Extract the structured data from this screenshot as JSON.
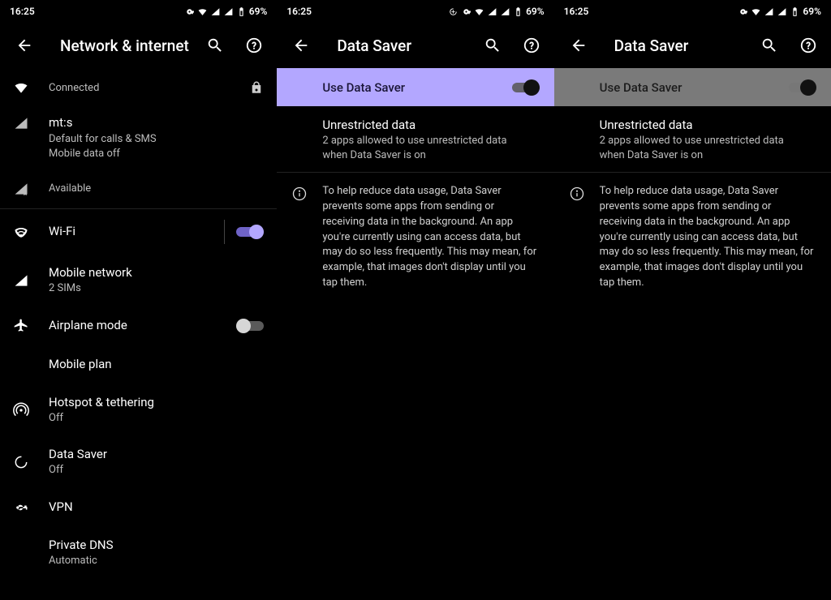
{
  "status": {
    "time": "16:25",
    "battery": "69%"
  },
  "panel1": {
    "title": "Network & internet",
    "rows": {
      "connected": {
        "sub": "Connected"
      },
      "mts": {
        "title": "mt:s",
        "sub1": "Default for calls & SMS",
        "sub2": "Mobile data off"
      },
      "available": {
        "sub": "Available"
      },
      "wifi": {
        "title": "Wi-Fi"
      },
      "mobilenet": {
        "title": "Mobile network",
        "sub": "2 SIMs"
      },
      "airplane": {
        "title": "Airplane mode"
      },
      "mobileplan": {
        "title": "Mobile plan"
      },
      "hotspot": {
        "title": "Hotspot & tethering",
        "sub": "Off"
      },
      "datasaver": {
        "title": "Data Saver",
        "sub": "Off"
      },
      "vpn": {
        "title": "VPN"
      },
      "privatedns": {
        "title": "Private DNS",
        "sub": "Automatic"
      }
    }
  },
  "panel2": {
    "title": "Data Saver",
    "toggle_label": "Use Data Saver",
    "unrestricted_title": "Unrestricted data",
    "unrestricted_sub": "2 apps allowed to use unrestricted data when Data Saver is on",
    "info_text": "To help reduce data usage, Data Saver prevents some apps from sending or receiving data in the background. An app you're currently using can access data, but may do so less frequently. This may mean, for example, that images don't display until you tap them."
  },
  "panel3": {
    "title": "Data Saver",
    "toggle_label": "Use Data Saver",
    "unrestricted_title": "Unrestricted data",
    "unrestricted_sub": "2 apps allowed to use unrestricted data when Data Saver is on",
    "info_text": "To help reduce data usage, Data Saver prevents some apps from sending or receiving data in the background. An app you're currently using can access data, but may do so less frequently. This may mean, for example, that images don't display until you tap them."
  }
}
